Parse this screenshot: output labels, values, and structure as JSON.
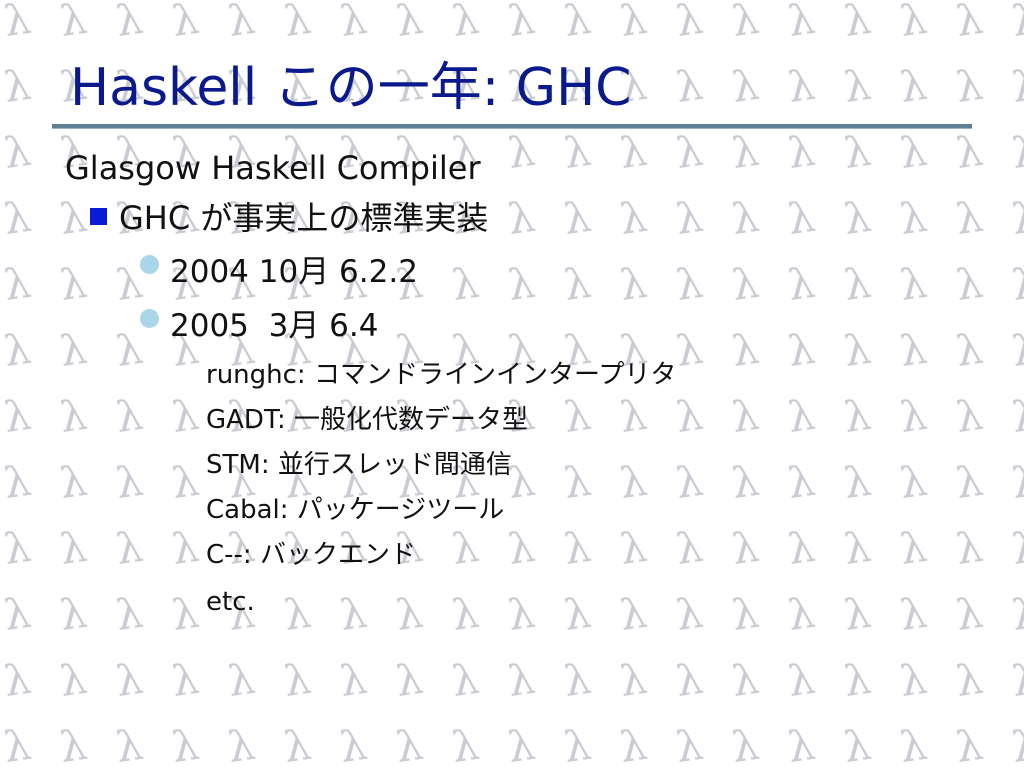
{
  "slide": {
    "title": "Haskell この一年: GHC",
    "level1": "Glasgow Haskell Compiler",
    "level2": "GHC が事実上の標準実装",
    "releases": [
      "2004 10月 6.2.2",
      "2005  3月 6.4"
    ],
    "features": [
      "runghc: コマンドラインインタープリタ",
      "GADT: 一般化代数データ型",
      "STM: 並行スレッド間通信",
      "Cabal: パッケージツール",
      "C--: バックエンド",
      "etc."
    ]
  },
  "colors": {
    "title": "#0a1a8c",
    "rule": "#5f7f93",
    "square_bullet": "#0a1ad8",
    "circle_bullet": "#a9d6e8",
    "background_pattern": "#c9ccd2"
  },
  "icons": {
    "background": "lambda-pattern",
    "level2_bullet": "square-bullet",
    "level3_bullet": "circle-bullet"
  }
}
